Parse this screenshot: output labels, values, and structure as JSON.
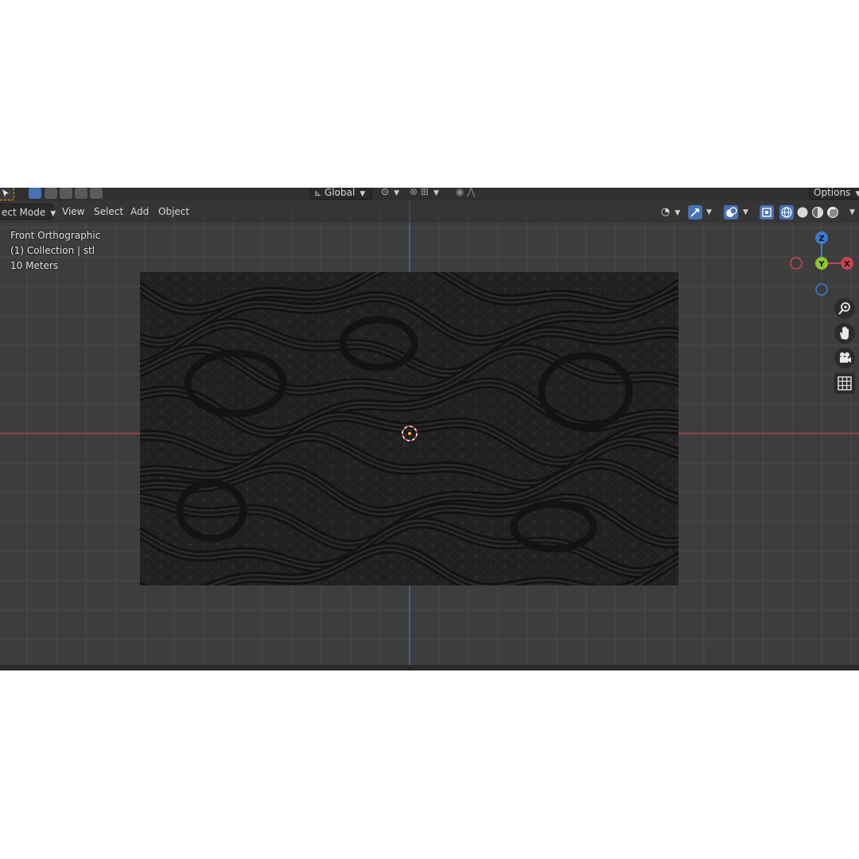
{
  "theme": {
    "viewport_bg": "#3d3d3d",
    "grid_line": "#4a4a4a",
    "x_axis": "#c9444f",
    "z_axis": "#3d7bd1",
    "y_axis": "#8ec733",
    "accent": "#4772b3",
    "model_bg": "#1f1f1f"
  },
  "toolbar": {
    "orientation_value": "Global",
    "options_label": "Options",
    "icons": [
      "select-box-icon",
      "mode-new-icon",
      "mode-extend-icon",
      "mode-subtract-icon",
      "mode-invert-icon",
      "mode-intersect-icon",
      "transform-orientation-icon",
      "pivot-icon",
      "snap-icon",
      "snap-increment-icon",
      "proportional-edit-icon",
      "falloff-icon"
    ]
  },
  "header": {
    "mode_label": "ect Mode",
    "menus": [
      "View",
      "Select",
      "Add",
      "Object"
    ],
    "right_icons": [
      "visibility-icon",
      "gizmo-icon",
      "overlay-icon",
      "xray-icon",
      "wireframe-shading-icon",
      "solid-shading-icon",
      "material-shading-icon",
      "rendered-shading-icon"
    ]
  },
  "viewport_info": {
    "view_name": "Front Orthographic",
    "collection": "(1) Collection | stl",
    "scale": "10 Meters"
  },
  "gizmo": {
    "z": "Z",
    "y": "Y",
    "x": "X"
  },
  "nav_tools": [
    "zoom-icon",
    "pan-hand-icon",
    "camera-icon",
    "grid-view-icon"
  ]
}
